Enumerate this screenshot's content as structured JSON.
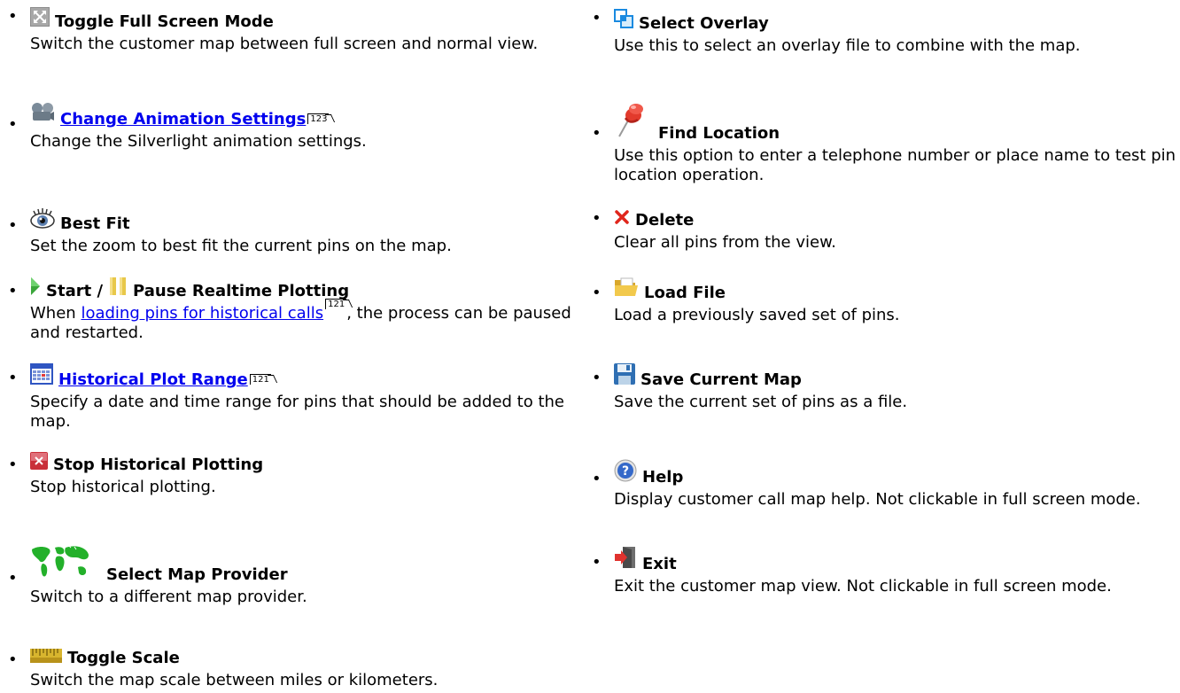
{
  "left_items": [
    {
      "title": "Toggle Full Screen Mode",
      "desc": "Switch the customer map between full screen and normal view.",
      "icon": "fullscreen-icon"
    },
    {
      "title": "Change Animation Settings",
      "ref": "123",
      "desc": "Change the Silverlight animation settings.",
      "icon": "animation-settings-icon"
    },
    {
      "title": "Best Fit",
      "desc": "Set the zoom to best fit the current pins on the map.",
      "icon": "eye-icon"
    },
    {
      "title_pre": "Start /",
      "title": "Pause Realtime Plotting",
      "desc_pre": "When",
      "desc_link": "loading pins for historical calls",
      "desc_ref": "121",
      "desc_post": ", the process can be paused and restarted.",
      "icon": "play-icon",
      "icon2": "pause-icon"
    },
    {
      "title": "Historical Plot Range",
      "ref": "121",
      "desc": "Specify a date and time range for pins that should be added to the map.",
      "icon": "calendar-icon"
    },
    {
      "title": "Stop Historical Plotting",
      "desc": "Stop historical plotting.",
      "icon": "stop-icon"
    },
    {
      "title": "Select Map Provider",
      "desc": "Switch to a different map provider.",
      "icon": "world-map-icon"
    },
    {
      "title": "Toggle Scale",
      "desc": "Switch the map scale between miles or kilometers.",
      "icon": "ruler-icon"
    }
  ],
  "right_items": [
    {
      "title": "Select Overlay",
      "desc": "Use this to select an overlay file to combine with the map.",
      "icon": "overlay-icon"
    },
    {
      "title": "Find Location",
      "desc": "Use this option to enter a telephone number or place name to test pin location operation.",
      "icon": "pushpin-icon"
    },
    {
      "title": "Delete",
      "desc": "Clear all pins from the view.",
      "icon": "delete-icon"
    },
    {
      "title": "Load File",
      "desc": "Load a previously saved set of pins.",
      "icon": "folder-icon"
    },
    {
      "title": "Save Current Map",
      "desc": "Save the current set of pins as a file.",
      "icon": "save-icon"
    },
    {
      "title": "Help",
      "desc": "Display customer call map help. Not clickable in full screen mode.",
      "icon": "help-icon"
    },
    {
      "title": "Exit",
      "desc": "Exit the customer map view. Not clickable in full screen mode.",
      "icon": "exit-icon"
    }
  ],
  "bullet": "•"
}
